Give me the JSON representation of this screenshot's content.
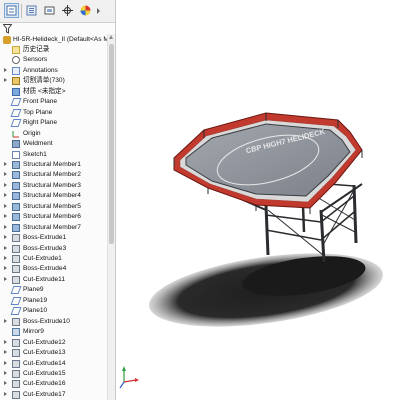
{
  "tree": {
    "root_label": "HI-5R-Helideck_II  (Default<As Ma",
    "items": [
      {
        "label": "历史记录",
        "icon": "history-icon",
        "kind": "folder",
        "expandable": false
      },
      {
        "label": "Sensors",
        "icon": "sensor-icon",
        "kind": "sensor",
        "expandable": false
      },
      {
        "label": "Annotations",
        "icon": "annotations-icon",
        "kind": "anno",
        "expandable": true
      },
      {
        "label": "切割清单(730)",
        "icon": "cut-list-icon",
        "kind": "cutlist",
        "expandable": true
      },
      {
        "label": "材质 <未指定>",
        "icon": "material-icon",
        "kind": "mat",
        "expandable": false
      },
      {
        "label": "Front Plane",
        "icon": "plane-icon",
        "kind": "plane",
        "expandable": false
      },
      {
        "label": "Top Plane",
        "icon": "plane-icon",
        "kind": "plane",
        "expandable": false
      },
      {
        "label": "Right Plane",
        "icon": "plane-icon",
        "kind": "plane",
        "expandable": false
      },
      {
        "label": "Origin",
        "icon": "origin-icon",
        "kind": "origin",
        "expandable": false
      },
      {
        "label": "Weldment",
        "icon": "weldment-icon",
        "kind": "weld",
        "expandable": false
      },
      {
        "label": "Sketch1",
        "icon": "sketch-icon",
        "kind": "sketch",
        "expandable": false
      },
      {
        "label": "Structural Member1",
        "icon": "structural-member-icon",
        "kind": "member",
        "expandable": true
      },
      {
        "label": "Structural Member2",
        "icon": "structural-member-icon",
        "kind": "member",
        "expandable": true
      },
      {
        "label": "Structural Member3",
        "icon": "structural-member-icon",
        "kind": "member",
        "expandable": true
      },
      {
        "label": "Structural Member4",
        "icon": "structural-member-icon",
        "kind": "member",
        "expandable": true
      },
      {
        "label": "Structural Member5",
        "icon": "structural-member-icon",
        "kind": "member",
        "expandable": true
      },
      {
        "label": "Structural Member6",
        "icon": "structural-member-icon",
        "kind": "member",
        "expandable": true
      },
      {
        "label": "Structural Member7",
        "icon": "structural-member-icon",
        "kind": "member",
        "expandable": true
      },
      {
        "label": "Boss-Extrude1",
        "icon": "extrude-icon",
        "kind": "extr",
        "expandable": true
      },
      {
        "label": "Boss-Extrude3",
        "icon": "extrude-icon",
        "kind": "extr",
        "expandable": true
      },
      {
        "label": "Cut-Extrude1",
        "icon": "cut-extrude-icon",
        "kind": "extr",
        "expandable": true
      },
      {
        "label": "Boss-Extrude4",
        "icon": "extrude-icon",
        "kind": "extr",
        "expandable": true
      },
      {
        "label": "Cut-Extrude11",
        "icon": "cut-extrude-icon",
        "kind": "extr",
        "expandable": true
      },
      {
        "label": "Plane9",
        "icon": "plane-icon",
        "kind": "plane",
        "expandable": false
      },
      {
        "label": "Plane19",
        "icon": "plane-icon",
        "kind": "plane",
        "expandable": false
      },
      {
        "label": "Plane10",
        "icon": "plane-icon",
        "kind": "plane",
        "expandable": false
      },
      {
        "label": "Boss-Extrude10",
        "icon": "extrude-icon",
        "kind": "extr",
        "expandable": true
      },
      {
        "label": "Mirror9",
        "icon": "mirror-icon",
        "kind": "mirror",
        "expandable": false
      },
      {
        "label": "Cut-Extrude12",
        "icon": "cut-extrude-icon",
        "kind": "extr",
        "expandable": true
      },
      {
        "label": "Cut-Extrude13",
        "icon": "cut-extrude-icon",
        "kind": "extr",
        "expandable": true
      },
      {
        "label": "Cut-Extrude14",
        "icon": "cut-extrude-icon",
        "kind": "extr",
        "expandable": true
      },
      {
        "label": "Cut-Extrude15",
        "icon": "cut-extrude-icon",
        "kind": "extr",
        "expandable": true
      },
      {
        "label": "Cut-Extrude16",
        "icon": "cut-extrude-icon",
        "kind": "extr",
        "expandable": true
      },
      {
        "label": "Cut-Extrude17",
        "icon": "cut-extrude-icon",
        "kind": "extr",
        "expandable": true
      }
    ]
  },
  "toolbar": {
    "buttons": [
      "feature-manager-icon",
      "property-manager-icon",
      "configuration-manager-icon",
      "dimxpert-icon",
      "display-manager-icon"
    ]
  },
  "deck": {
    "marking": "CBP HIGH7 HELIDECK"
  },
  "colors": {
    "tree_bg": "#fbfbfb",
    "deck_surface": "#8f949c",
    "deck_edge": "#b03028",
    "structure": "#2a2c30",
    "shadow": "#262626"
  }
}
